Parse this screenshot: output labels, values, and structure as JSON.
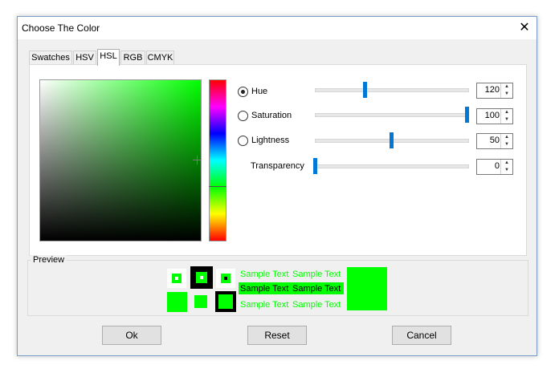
{
  "window": {
    "title": "Choose The Color"
  },
  "tabs": [
    {
      "label": "Swatches",
      "active": false
    },
    {
      "label": "HSV",
      "active": false
    },
    {
      "label": "HSL",
      "active": true
    },
    {
      "label": "RGB",
      "active": false
    },
    {
      "label": "CMYK",
      "active": false
    }
  ],
  "controls": {
    "hue": {
      "label": "Hue",
      "value": "120",
      "selected": true
    },
    "saturation": {
      "label": "Saturation",
      "value": "100",
      "selected": false
    },
    "lightness": {
      "label": "Lightness",
      "value": "50",
      "selected": false
    },
    "transparency": {
      "label": "Transparency",
      "value": "0"
    }
  },
  "preview": {
    "label": "Preview",
    "sample_text": "Sample Text",
    "color": "#00ff00"
  },
  "buttons": {
    "ok": "Ok",
    "reset": "Reset",
    "cancel": "Cancel"
  }
}
